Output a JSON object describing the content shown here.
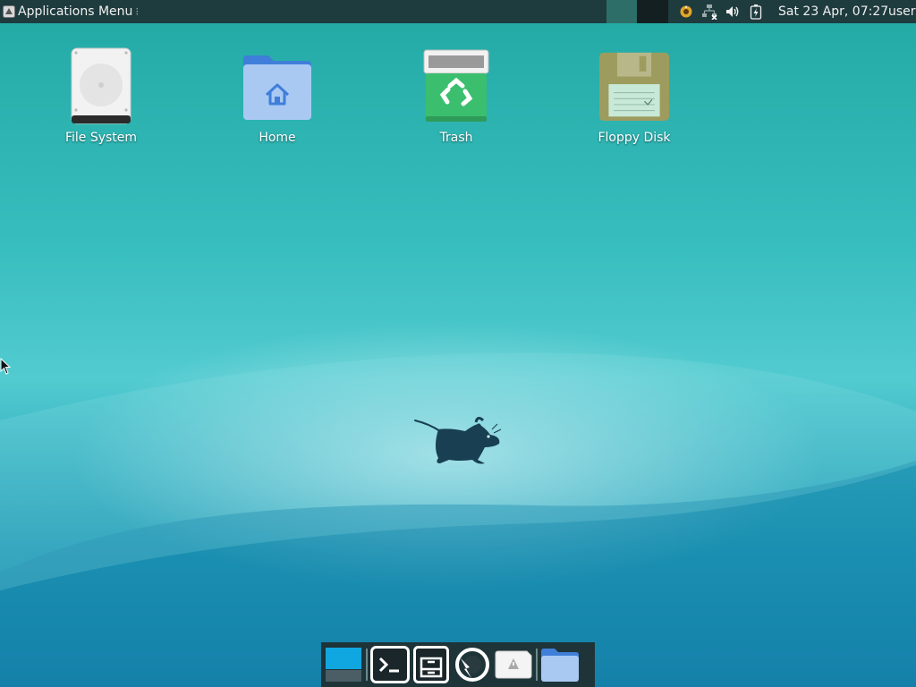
{
  "panel": {
    "app_menu_label": "Applications Menu",
    "clock": "Sat 23 Apr, 07:27",
    "user": "user"
  },
  "tray": {
    "icons": [
      "updates-icon",
      "network-disconnected-icon",
      "volume-icon",
      "battery-icon"
    ]
  },
  "desktop": {
    "icons": [
      {
        "label": "File System",
        "icon": "harddisk-icon"
      },
      {
        "label": "Home",
        "icon": "home-folder-icon"
      },
      {
        "label": "Trash",
        "icon": "trash-icon"
      },
      {
        "label": "Floppy Disk",
        "icon": "floppy-icon"
      }
    ]
  },
  "dock": {
    "items": [
      "show-desktop-icon",
      "terminal-icon",
      "file-manager-icon",
      "web-browser-icon",
      "app-finder-icon",
      "folder-icon"
    ]
  },
  "colors": {
    "panel_bg": "#1e3b3e",
    "desktop_teal": "#37bdbd",
    "dock_bg": "#1e3438"
  }
}
